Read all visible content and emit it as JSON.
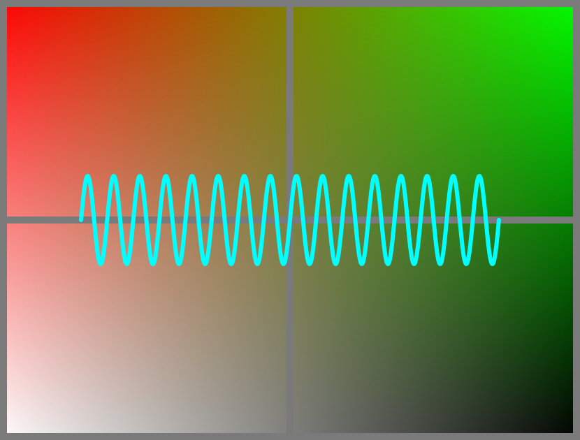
{
  "colors": {
    "frame": "#7a7a7a",
    "corner_top_left": "#ff0000",
    "corner_top_right": "#00ff00",
    "corner_bottom_left": "#ffffff",
    "corner_bottom_right": "#000000",
    "wave": "#00ffff"
  },
  "pattern": {
    "panels": 4,
    "wave_cycles": 16,
    "wave_direction": "horizontal"
  }
}
